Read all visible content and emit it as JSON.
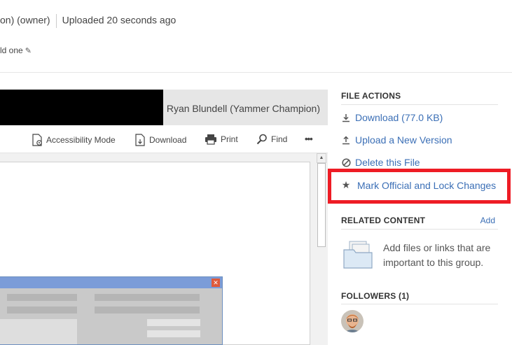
{
  "header": {
    "owner_text": "on) (owner)",
    "uploaded_text": "Uploaded 20 seconds ago",
    "description_text": "ld one"
  },
  "preview": {
    "owner_name": "Ryan Blundell (Yammer Champion)",
    "toolbar": {
      "accessibility": "Accessibility Mode",
      "download": "Download",
      "print": "Print",
      "find": "Find",
      "more": "•••"
    }
  },
  "sidebar": {
    "file_actions_title": "FILE ACTIONS",
    "actions": {
      "download": "Download (77.0 KB)",
      "upload": "Upload a New Version",
      "delete": "Delete this File",
      "mark_official": "Mark Official and Lock Changes"
    },
    "related_title": "RELATED CONTENT",
    "related_add": "Add",
    "related_text": "Add files or links that are important to this group.",
    "followers_title": "FOLLOWERS (1)"
  },
  "colors": {
    "link": "#3b6fb6",
    "highlight": "#ee1c25"
  }
}
